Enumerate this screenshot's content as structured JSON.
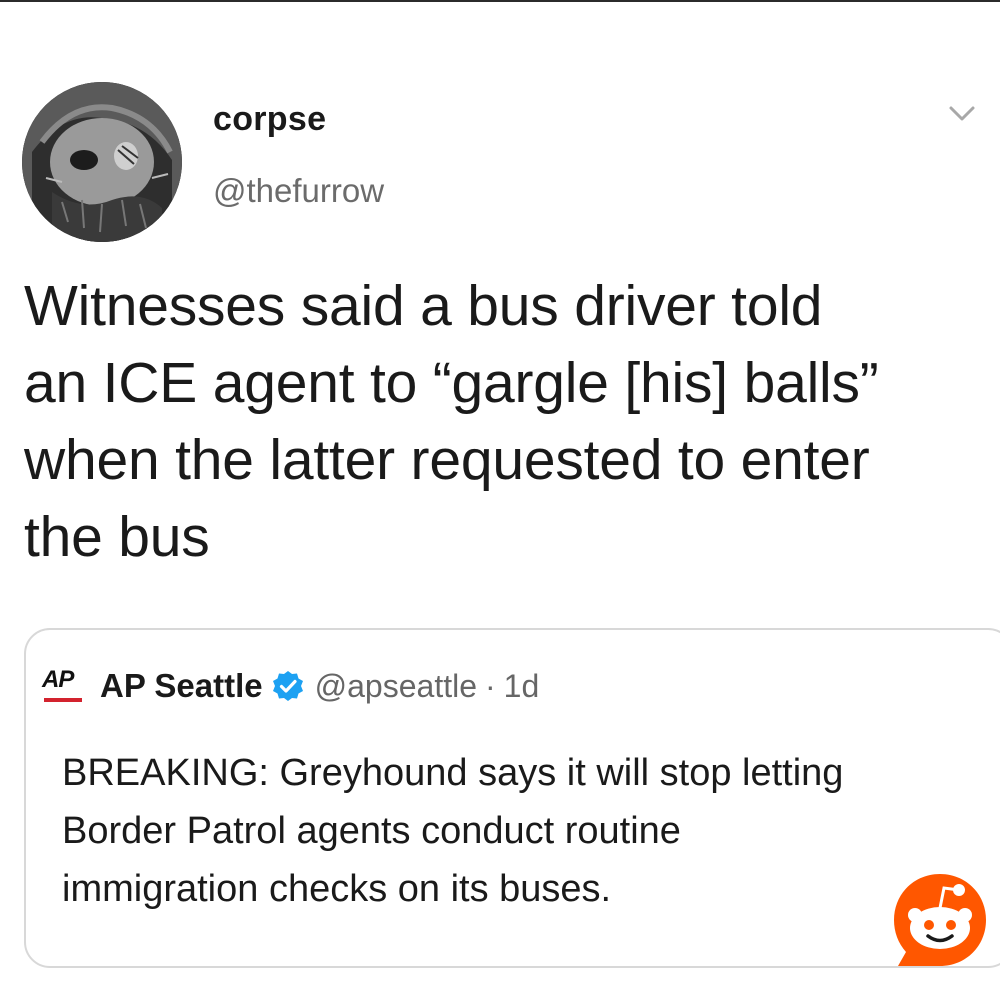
{
  "tweet": {
    "display_name": "corpse",
    "handle": "@thefurrow",
    "text_lines": [
      "Witnesses said a bus driver told",
      "an ICE agent to “gargle [his] balls”",
      "when the latter requested to enter",
      "the bus"
    ]
  },
  "quoted_tweet": {
    "logo_text": "AP",
    "name": "AP Seattle",
    "verified": true,
    "handle": "@apseattle",
    "separator": "·",
    "time": "1d",
    "text_lines": [
      "BREAKING: Greyhound says it will stop letting",
      "Border Patrol agents conduct routine",
      "immigration checks on its buses."
    ]
  },
  "icons": {
    "avatar": "avatar-image",
    "menu": "chevron-down-icon",
    "verified": "verified-badge-icon",
    "watermark": "reddit-logo-icon"
  },
  "colors": {
    "verified_blue": "#1da1f2",
    "ap_red": "#d3232e",
    "reddit_orange": "#ff5700",
    "handle_gray": "#6b6b6b"
  }
}
